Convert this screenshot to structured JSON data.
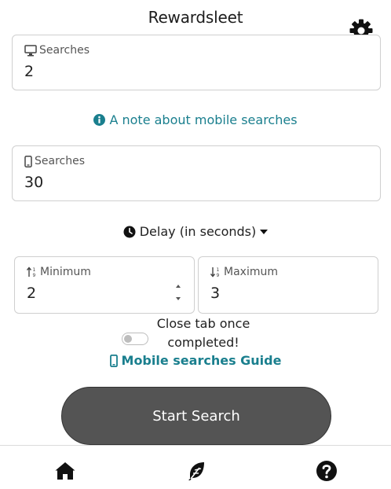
{
  "app": {
    "title": "Rewardsleet"
  },
  "desktop": {
    "label": "Searches",
    "value": "2"
  },
  "note_link": "A note about mobile searches",
  "mobile": {
    "label": "Searches",
    "value": "30"
  },
  "delay": {
    "toggle_label": "Delay (in seconds)",
    "minimum": {
      "label": "Minimum",
      "value": "2"
    },
    "maximum": {
      "label": "Maximum",
      "value": "3"
    }
  },
  "close_tab": {
    "line1": "Close tab once",
    "line2": "completed!",
    "enabled": false
  },
  "guide_link": "Mobile searches Guide",
  "start_button": "Start Search",
  "icons": {
    "settings": "gear-icon",
    "desktop": "desktop-icon",
    "info": "info-circle-icon",
    "mobile": "mobile-icon",
    "clock": "clock-icon",
    "caret": "caret-down-icon",
    "sort_asc": "sort-numeric-up-icon",
    "sort_desc": "sort-numeric-down-icon",
    "home": "home-icon",
    "feather": "feather-icon",
    "help": "question-circle-icon"
  },
  "colors": {
    "link": "#1a7f8e",
    "button": "#545454",
    "icon": "#111111"
  }
}
